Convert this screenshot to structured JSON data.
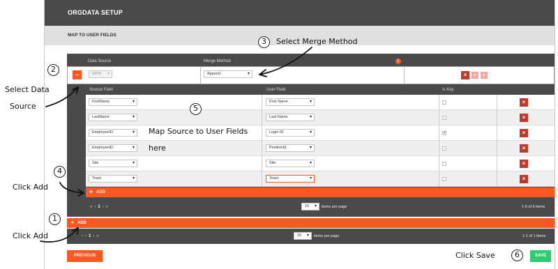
{
  "header": {
    "title": "ORGDATA SETUP"
  },
  "subheader": {
    "title": "MAP TO USER FIELDS"
  },
  "source_row": {
    "data_source_label": "Data Source",
    "merge_method_label": "Merge Method",
    "data_source_value": "WFM",
    "merge_method_value": "Append",
    "minus_label": "–",
    "info_icon": "info-icon"
  },
  "mapping_table": {
    "headers": {
      "source_field": "Source Field",
      "user_field": "User Field",
      "is_key": "Is Key"
    },
    "rows": [
      {
        "source": "FirstName",
        "user": "First Name",
        "key": false
      },
      {
        "source": "LastName",
        "user": "Last Name",
        "key": false
      },
      {
        "source": "EmployeeID",
        "user": "Login ID",
        "key": true
      },
      {
        "source": "EmployeeID",
        "user": "PositionId",
        "key": false
      },
      {
        "source": "Site",
        "user": "Site",
        "key": false
      },
      {
        "source": "Team",
        "user": "Team",
        "key": false
      }
    ],
    "add_label": "ADD",
    "pager": {
      "page": "1",
      "page_size": "10",
      "per_page_label": "items per page",
      "summary": "1-6 of 6 items"
    }
  },
  "outer": {
    "add_label": "ADD",
    "pager": {
      "page": "1",
      "page_size": "10",
      "per_page_label": "items per page",
      "summary": "1-1 of 1 items"
    }
  },
  "footer": {
    "previous_label": "PREVIOUS",
    "save_label": "SAVE"
  },
  "annotations": {
    "n1": "1",
    "n2": "2",
    "n3": "3",
    "n4": "4",
    "n5": "5",
    "n6": "6",
    "select_merge": "Select Merge Method",
    "select_data_1": "Select Data",
    "select_data_2": "Source",
    "map_1": "Map Source to User Fields",
    "map_2": "here",
    "click_add_1": "Click Add",
    "click_add_2": "Click Add",
    "click_save": "Click Save"
  },
  "colors": {
    "accent": "#ff5722",
    "header": "#4a4a4a",
    "delete": "#c0392b",
    "save": "#2ecc71"
  }
}
